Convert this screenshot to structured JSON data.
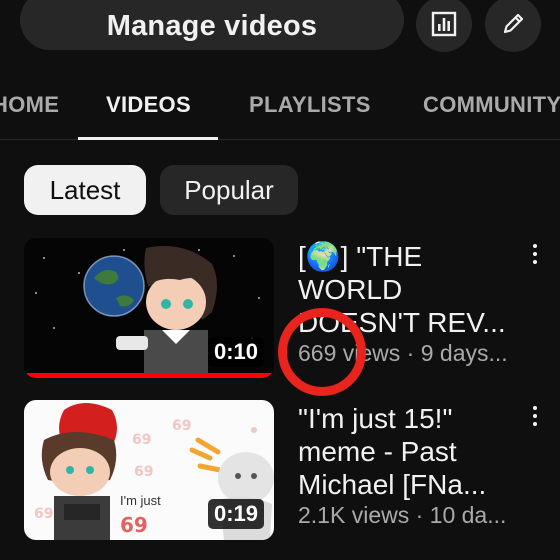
{
  "header": {
    "manage_videos_label": "Manage videos",
    "analytics_icon": "analytics-icon",
    "edit_icon": "pencil-icon"
  },
  "tabs": [
    {
      "label": "HOME",
      "active": false
    },
    {
      "label": "VIDEOS",
      "active": true
    },
    {
      "label": "PLAYLISTS",
      "active": false
    },
    {
      "label": "COMMUNITY",
      "active": false
    }
  ],
  "filters": {
    "latest_label": "Latest",
    "popular_label": "Popular",
    "selected": "Latest"
  },
  "videos": [
    {
      "title": "[🌍] \"THE WORLD DOESN'T REV...",
      "views": "669 views",
      "age": "9 days...",
      "duration": "0:10",
      "thumb_text": ""
    },
    {
      "title": "\"I'm just 15!\" meme - Past Michael [FNa...",
      "views": "2.1K views",
      "age": "10 da...",
      "duration": "0:19",
      "thumb_text": "I'm just"
    }
  ],
  "colors": {
    "background": "#0f0f0f",
    "surface": "#272727",
    "progress": "#ff0000",
    "annotation_ring": "#e8241c"
  }
}
